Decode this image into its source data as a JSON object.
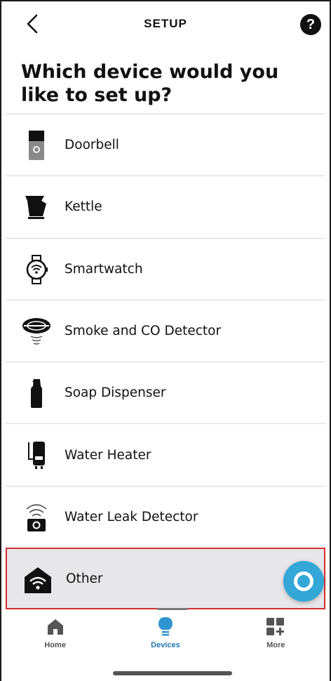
{
  "header": {
    "title": "SETUP",
    "help_label": "?"
  },
  "heading": "Which device would you like to set up?",
  "devices": [
    {
      "label": "Doorbell",
      "icon": "doorbell-icon"
    },
    {
      "label": "Kettle",
      "icon": "kettle-icon"
    },
    {
      "label": "Smartwatch",
      "icon": "smartwatch-icon"
    },
    {
      "label": "Smoke and CO Detector",
      "icon": "smoke-detector-icon"
    },
    {
      "label": "Soap Dispenser",
      "icon": "soap-dispenser-icon"
    },
    {
      "label": "Water Heater",
      "icon": "water-heater-icon"
    },
    {
      "label": "Water Leak Detector",
      "icon": "water-leak-detector-icon"
    },
    {
      "label": "Other",
      "icon": "home-wifi-icon",
      "selected": true
    }
  ],
  "tabs": [
    {
      "label": "Home",
      "icon": "home-icon",
      "active": false
    },
    {
      "label": "Devices",
      "icon": "lightbulb-icon",
      "active": true
    },
    {
      "label": "More",
      "icon": "grid-plus-icon",
      "active": false
    }
  ],
  "colors": {
    "accent": "#33a7d6",
    "active_tab": "#2277b3",
    "selection_border": "#d32f2f",
    "selection_bg": "#e7e7ea"
  }
}
